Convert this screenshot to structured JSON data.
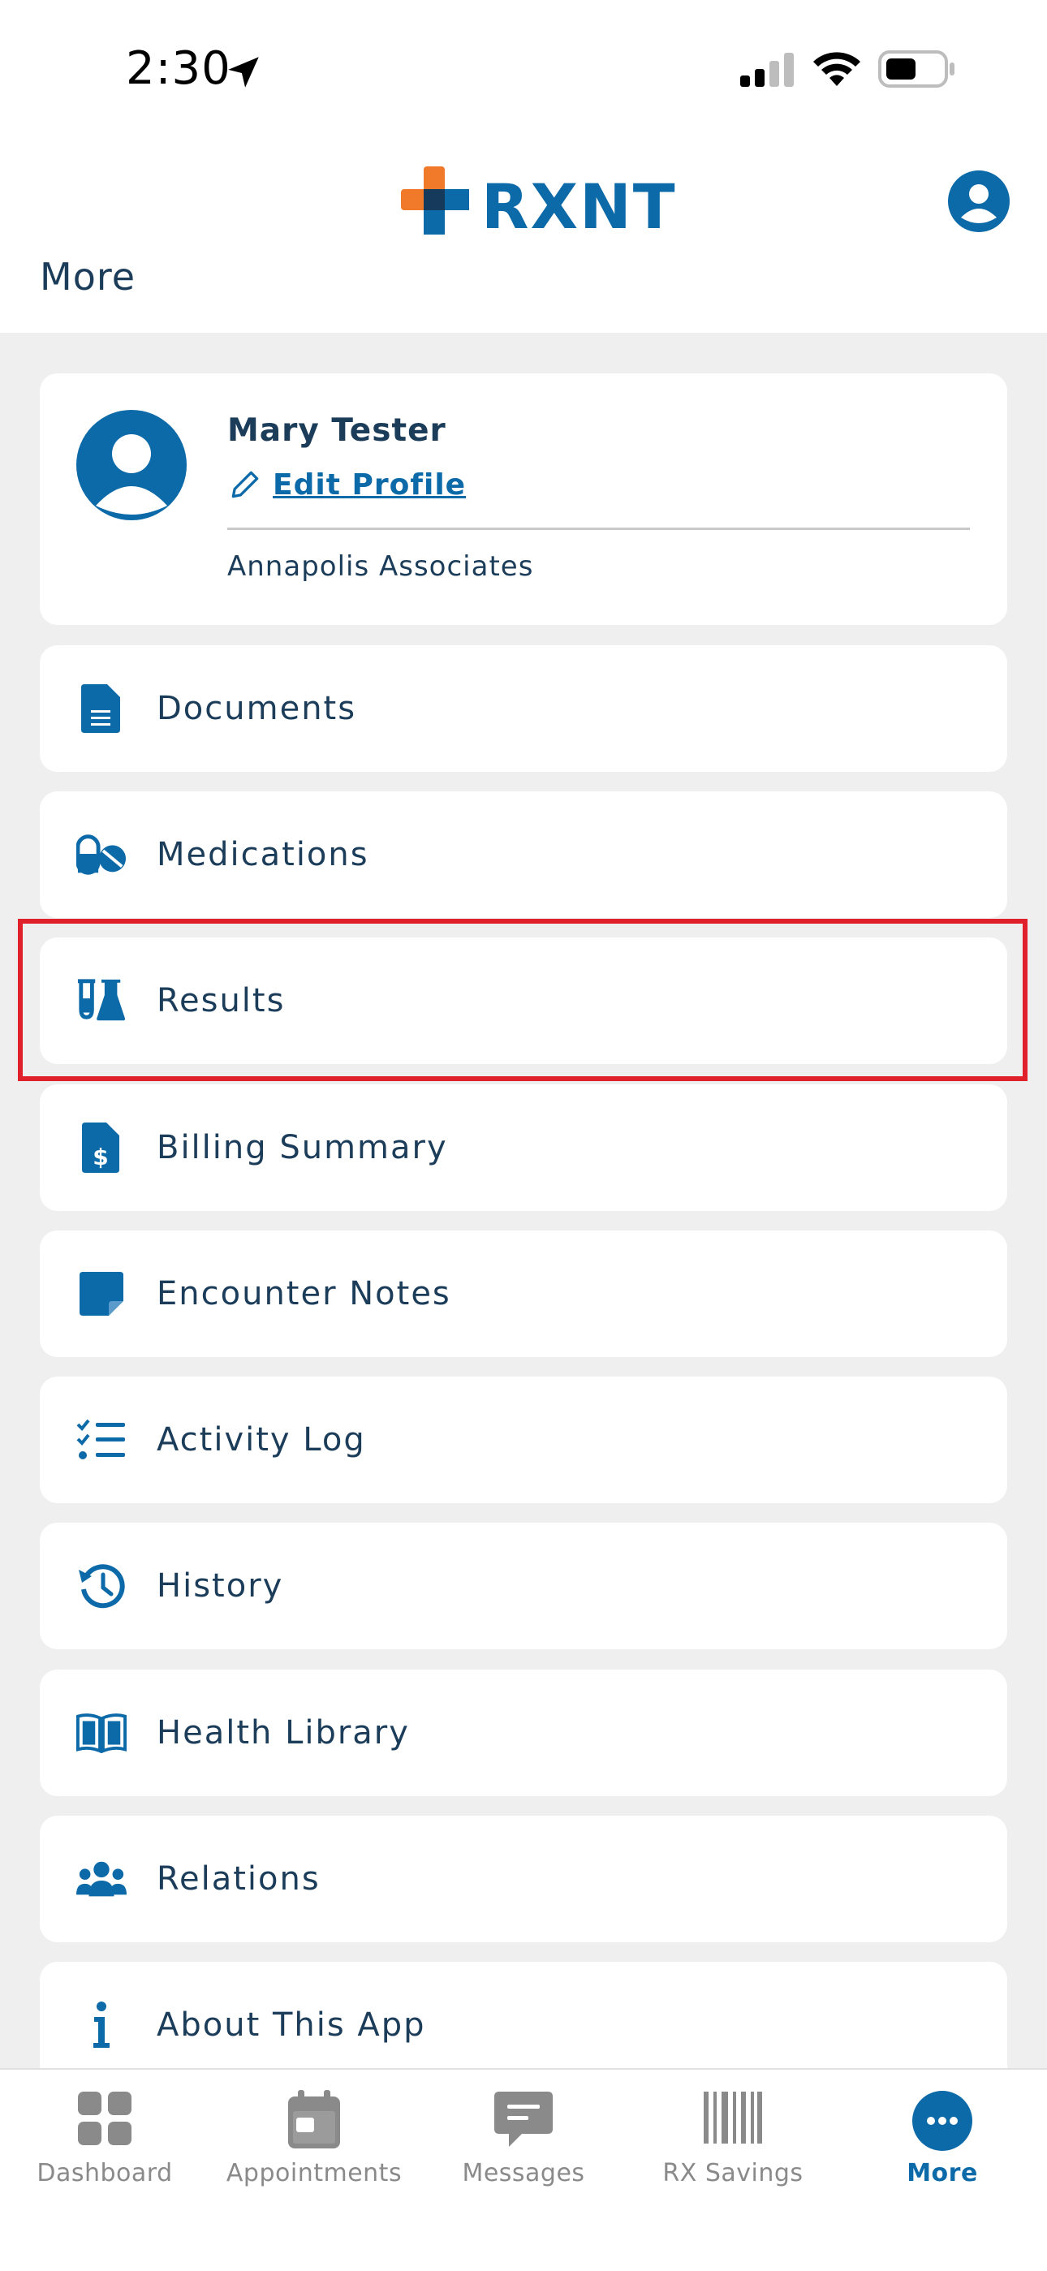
{
  "status_bar": {
    "time": "2:30"
  },
  "header": {
    "brand": "RXNT",
    "title": "More"
  },
  "profile": {
    "name": "Mary Tester",
    "edit_label": "Edit Profile",
    "practice": "Annapolis Associates"
  },
  "menu": [
    {
      "label": "Documents",
      "icon": "document-icon"
    },
    {
      "label": "Medications",
      "icon": "pills-icon"
    },
    {
      "label": "Results",
      "icon": "flask-icon"
    },
    {
      "label": "Billing Summary",
      "icon": "invoice-dollar-icon"
    },
    {
      "label": "Encounter Notes",
      "icon": "sticky-note-icon"
    },
    {
      "label": "Activity Log",
      "icon": "checklist-icon"
    },
    {
      "label": "History",
      "icon": "history-clock-icon"
    },
    {
      "label": "Health Library",
      "icon": "book-open-icon"
    },
    {
      "label": "Relations",
      "icon": "users-icon"
    },
    {
      "label": "About This App",
      "icon": "info-icon"
    }
  ],
  "tabs": [
    {
      "label": "Dashboard",
      "icon": "grid-icon"
    },
    {
      "label": "Appointments",
      "icon": "calendar-icon"
    },
    {
      "label": "Messages",
      "icon": "message-icon"
    },
    {
      "label": "RX Savings",
      "icon": "barcode-icon"
    },
    {
      "label": "More",
      "icon": "more-dots-icon",
      "active": true
    }
  ],
  "colors": {
    "brand": "#0d6aa8",
    "accent_orange": "#f07a2a",
    "highlight": "#e0202a"
  }
}
